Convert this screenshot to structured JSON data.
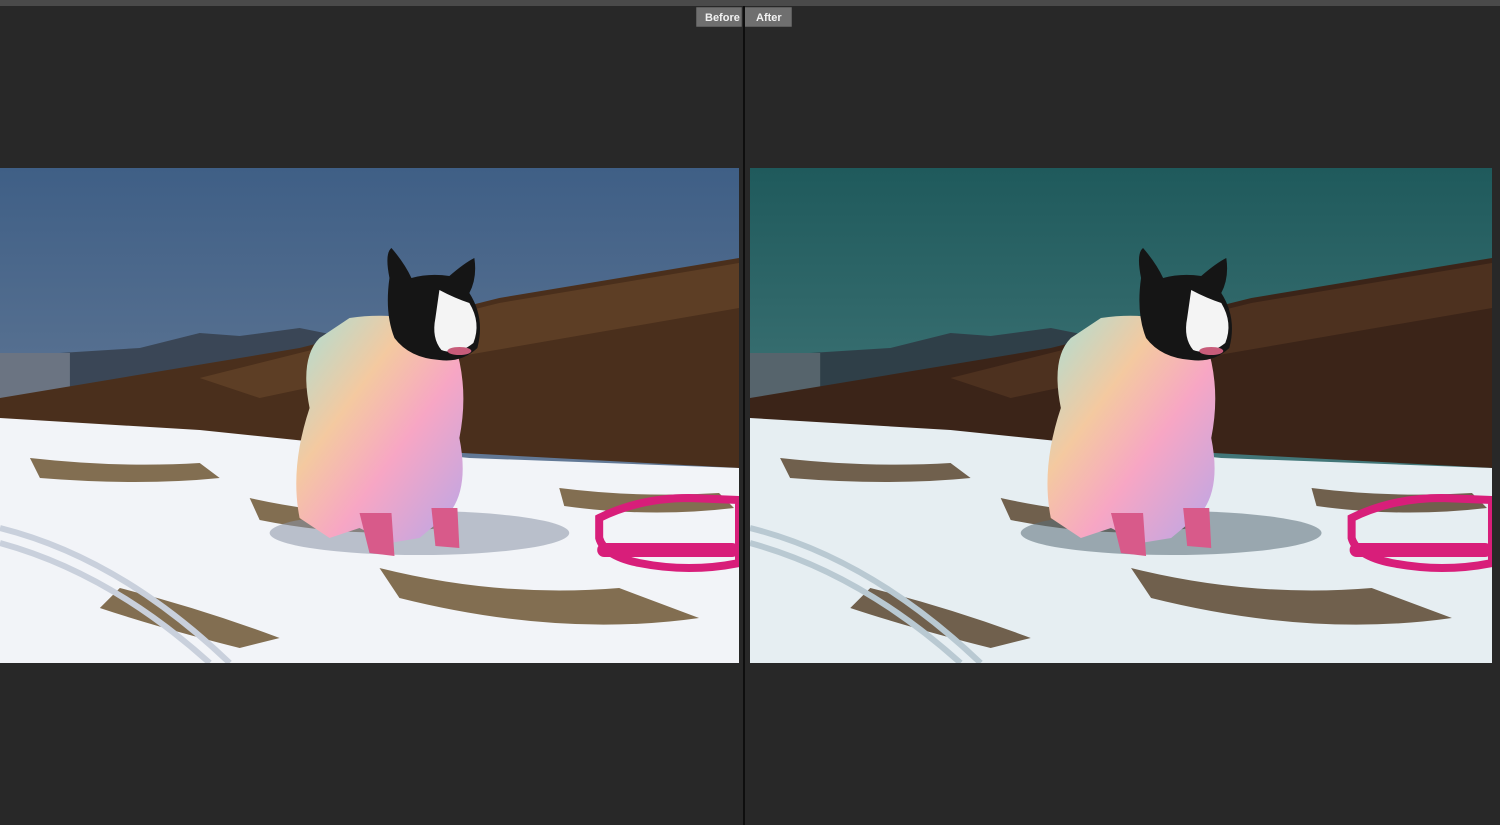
{
  "toolbar": {
    "before_label": "Before",
    "after_label": "After"
  },
  "panels": {
    "before": {
      "image": "dog-in-snow-photo-original",
      "sky_top": "#3f5f86",
      "sky_bottom": "#7a8aa0",
      "grade": "none"
    },
    "after": {
      "image": "dog-in-snow-photo-edited",
      "sky_top": "#1f5a5c",
      "sky_bottom": "#5a8a8c",
      "grade": "teal-cool"
    }
  },
  "colors": {
    "background": "#282828",
    "divider": "#0e0e0e",
    "button_bg": "#6f6f6f",
    "button_text": "#f2f2f2",
    "leash": "#d81e7a"
  }
}
